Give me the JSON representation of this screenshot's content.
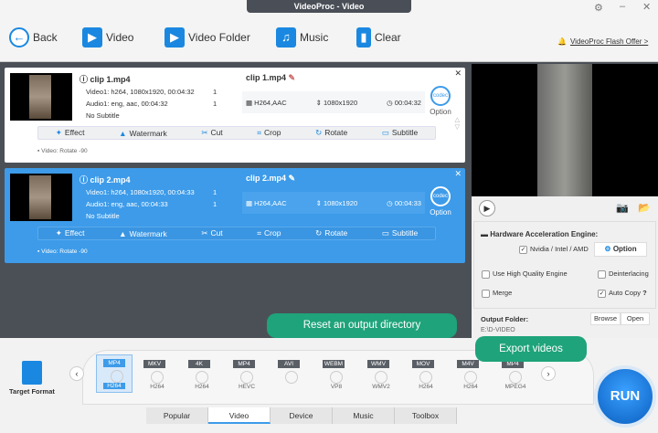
{
  "window": {
    "title": "VideoProc - Video"
  },
  "toolbar": {
    "back": "Back",
    "video": "Video",
    "video_folder": "Video Folder",
    "music": "Music",
    "clear": "Clear",
    "offer": "VideoProc Flash Offer >"
  },
  "clips": [
    {
      "name": "clip 1.mp4",
      "video": "Video1: h264, 1080x1920, 00:04:32",
      "audio": "Audio1: eng, aac, 00:04:32",
      "subtitle": "No Subtitle",
      "video_count": "1",
      "audio_count": "1",
      "output_name": "clip 1.mp4",
      "codec": "H264,AAC",
      "resolution": "1080x1920",
      "duration": "00:04:32",
      "option": "Option",
      "note": "Video: Rotate -90",
      "selected": false
    },
    {
      "name": "clip 2.mp4",
      "video": "Video1: h264, 1080x1920, 00:04:33",
      "audio": "Audio1: eng, aac, 00:04:33",
      "subtitle": "No Subtitle",
      "video_count": "1",
      "audio_count": "1",
      "output_name": "clip 2.mp4",
      "codec": "H264,AAC",
      "resolution": "1080x1920",
      "duration": "00:04:33",
      "option": "Option",
      "note": "Video: Rotate -90",
      "selected": true
    }
  ],
  "edit_tools": [
    "Effect",
    "Watermark",
    "Cut",
    "Crop",
    "Rotate",
    "Subtitle"
  ],
  "codec_icon_text": "codec",
  "settings": {
    "hw_title": "Hardware Acceleration Engine:",
    "hw_option": "Nvidia / Intel / AMD",
    "hw_checked": true,
    "option_btn": "Option",
    "high_quality": "Use High Quality Engine",
    "deinterlacing": "Deinterlacing",
    "merge": "Merge",
    "auto_copy": "Auto Copy",
    "auto_copy_checked": true,
    "help": "?"
  },
  "output": {
    "label": "Output Folder:",
    "path": "E:\\D-VIDEO",
    "browse": "Browse",
    "open": "Open"
  },
  "target_format": {
    "label": "Target Format"
  },
  "formats": [
    {
      "top": "MP4",
      "bottom": "H264",
      "selected": true
    },
    {
      "top": "MKV",
      "bottom": "H264"
    },
    {
      "top": "4K",
      "bottom": "H264"
    },
    {
      "top": "MP4",
      "bottom": "HEVC"
    },
    {
      "top": "AVI",
      "bottom": ""
    },
    {
      "top": "WEBM",
      "bottom": "VP8"
    },
    {
      "top": "WMV",
      "bottom": "WMV2"
    },
    {
      "top": "MOV",
      "bottom": "H264"
    },
    {
      "top": "M4V",
      "bottom": "H264"
    },
    {
      "top": "MP4",
      "bottom": "MPEG4"
    }
  ],
  "tabs": [
    "Popular",
    "Video",
    "Device",
    "Music",
    "Toolbox"
  ],
  "active_tab": "Video",
  "run": "RUN",
  "callouts": {
    "reset": "Reset an output directory",
    "export": "Export videos"
  },
  "colors": {
    "accent": "#3d9be9",
    "callout": "#1fa37a",
    "offer": "#e8541c"
  }
}
